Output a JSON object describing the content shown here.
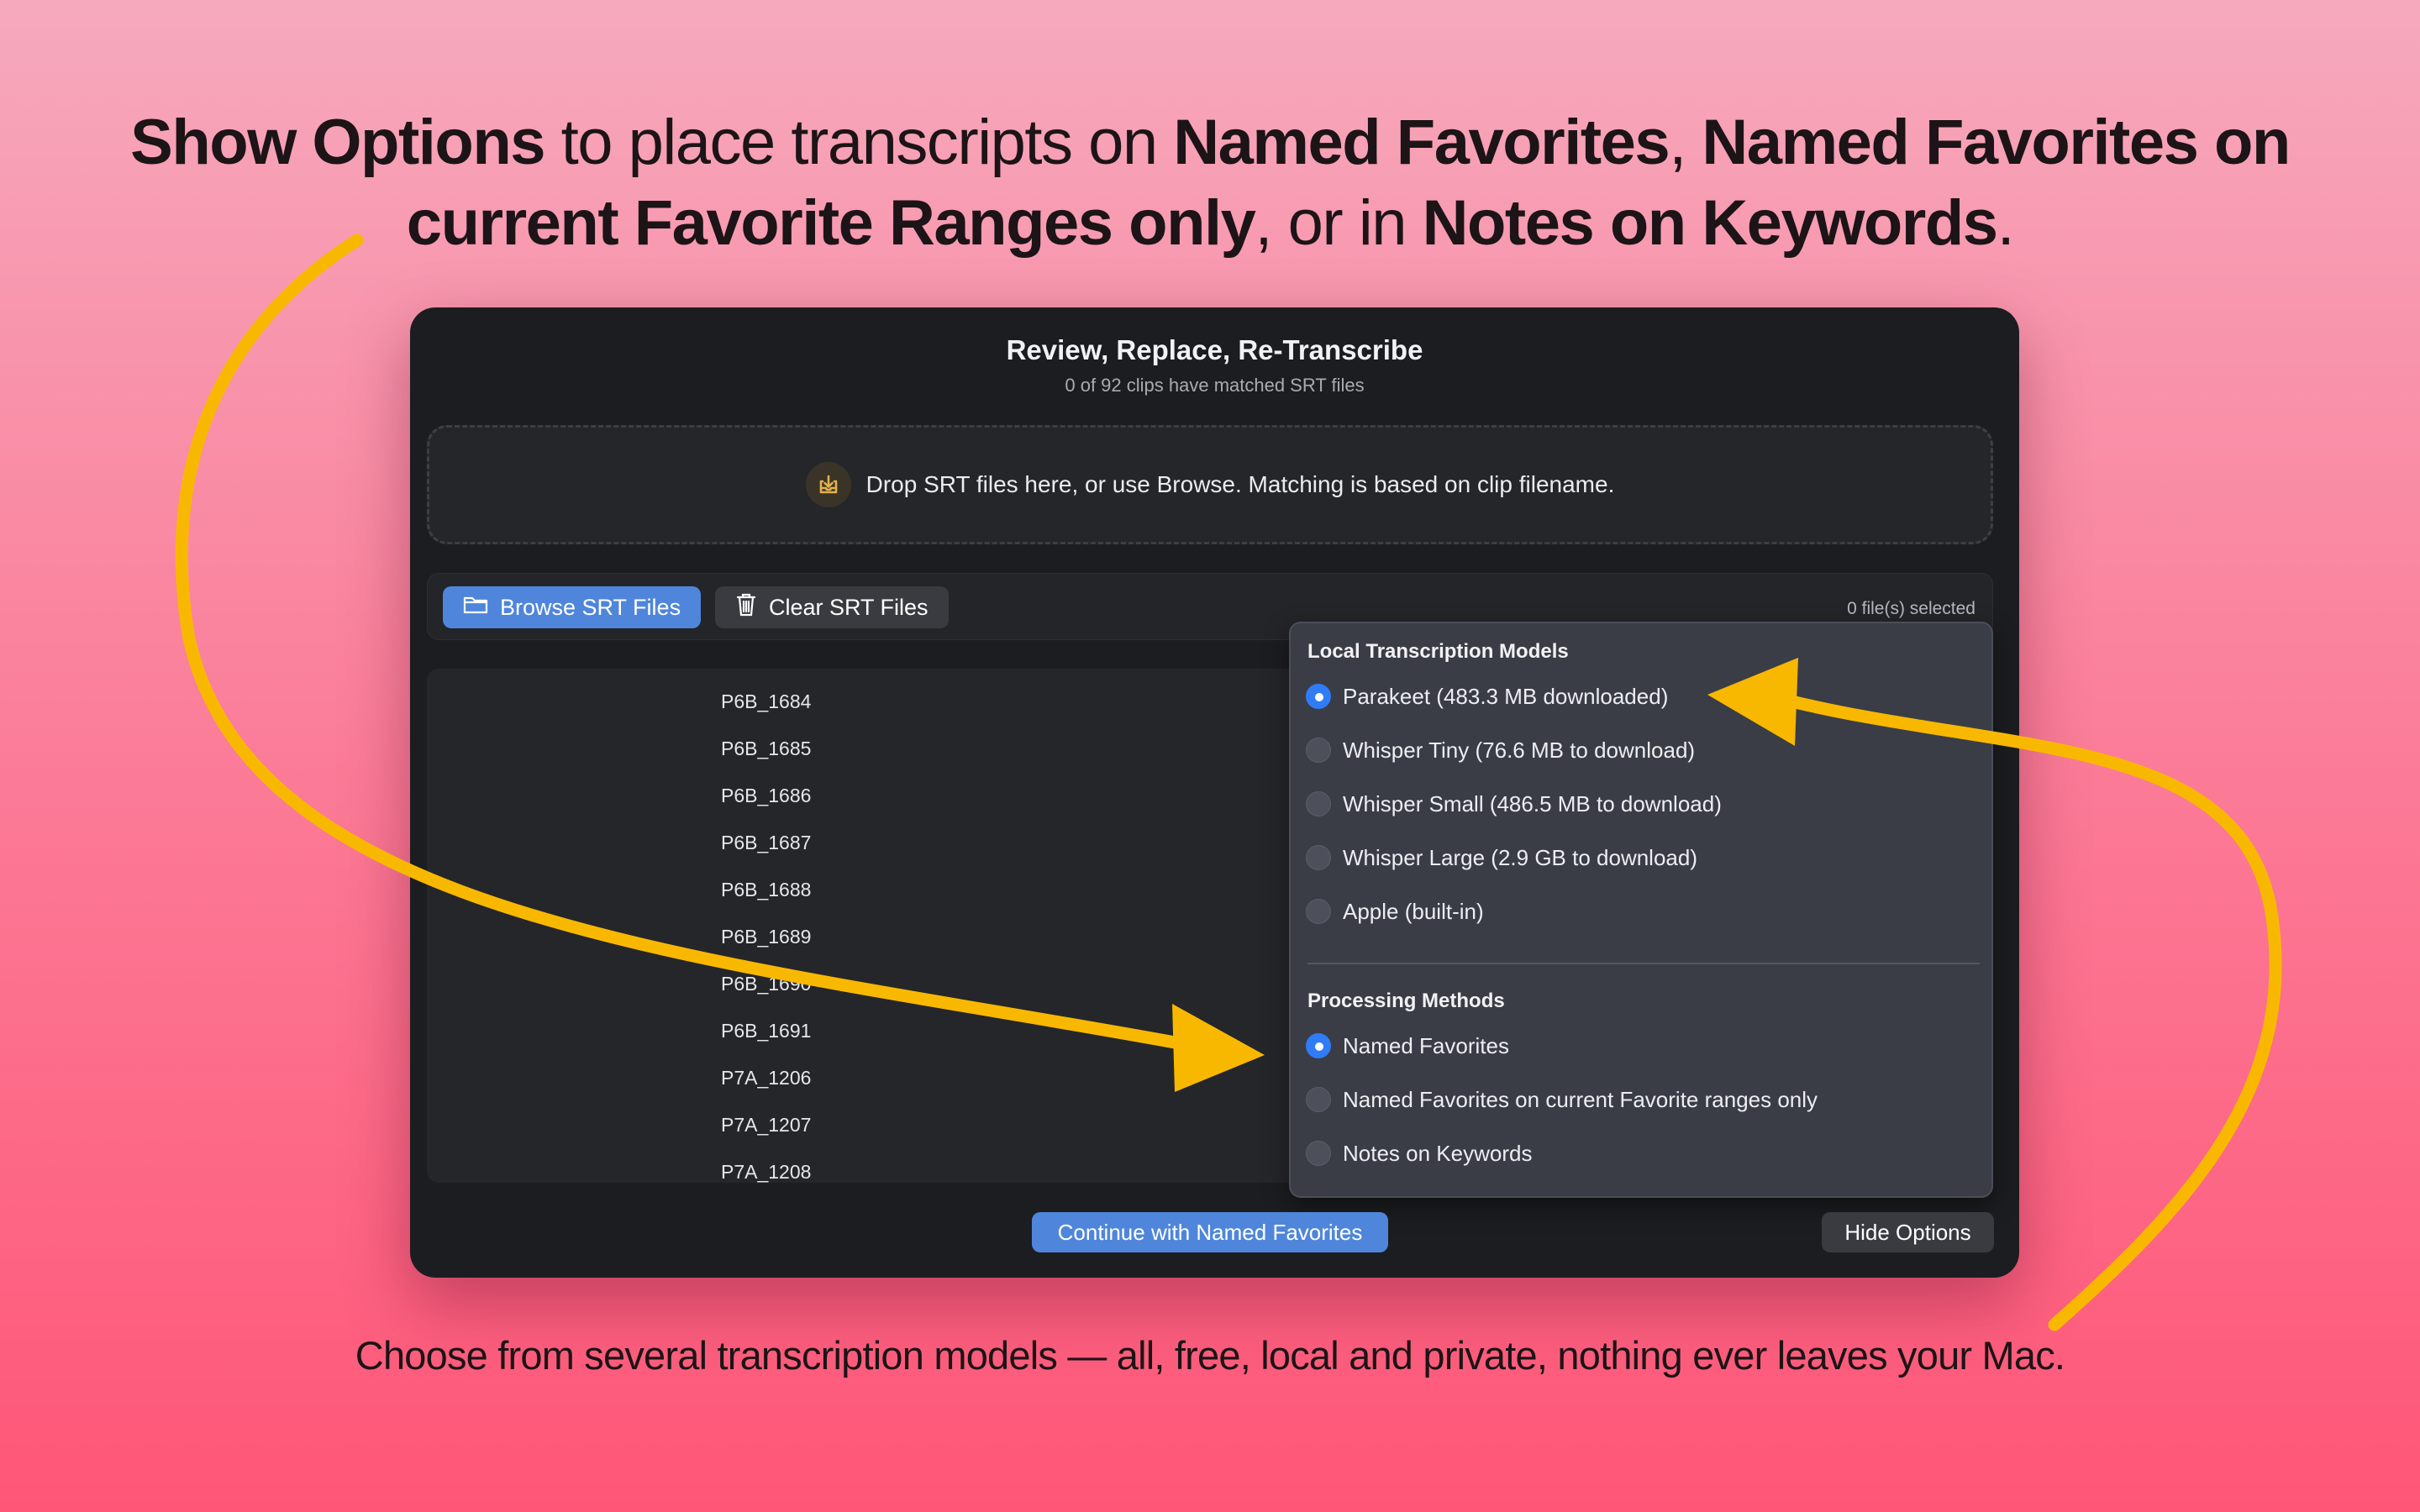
{
  "headline": {
    "part1_bold": "Show Options",
    "part2": " to place transcripts on ",
    "part3_bold": "Named Favorites",
    "part4": ", ",
    "part5_bold": "Named Favorites on current Favorite Ranges only",
    "part6": ", or in ",
    "part7_bold": "Notes on Keywords",
    "part8": "."
  },
  "footer_caption": "Choose from several transcription models — all, free, local and private, nothing ever leaves your Mac.",
  "window": {
    "title": "Review, Replace, Re-Transcribe",
    "subtitle": "0 of 92 clips have matched SRT files"
  },
  "dropzone": {
    "text": "Drop SRT files here, or use Browse. Matching is based on clip filename.",
    "icon": "download-tray-icon"
  },
  "toolbar": {
    "browse_label": "Browse SRT Files",
    "clear_label": "Clear SRT Files",
    "files_selected": "0 file(s) selected"
  },
  "clips": [
    "P6B_1684",
    "P6B_1685",
    "P6B_1686",
    "P6B_1687",
    "P6B_1688",
    "P6B_1689",
    "P6B_1690",
    "P6B_1691",
    "P7A_1206",
    "P7A_1207",
    "P7A_1208"
  ],
  "options": {
    "models_heading": "Local Transcription Models",
    "models": [
      {
        "label": "Parakeet (483.3 MB downloaded)",
        "selected": true
      },
      {
        "label": "Whisper Tiny (76.6 MB to download)",
        "selected": false
      },
      {
        "label": "Whisper Small (486.5 MB to download)",
        "selected": false
      },
      {
        "label": "Whisper Large (2.9 GB to download)",
        "selected": false
      },
      {
        "label": "Apple (built-in)",
        "selected": false
      }
    ],
    "methods_heading": "Processing Methods",
    "methods": [
      {
        "label": "Named Favorites",
        "selected": true
      },
      {
        "label": "Named Favorites on current Favorite ranges only",
        "selected": false
      },
      {
        "label": "Notes on Keywords",
        "selected": false
      }
    ]
  },
  "footer_buttons": {
    "continue_label": "Continue with Named Favorites",
    "hide_label": "Hide Options"
  },
  "colors": {
    "accent": "#4f86db",
    "radio_on": "#2f7cf6",
    "arrow": "#f9b800",
    "window_bg": "#1c1d20"
  }
}
